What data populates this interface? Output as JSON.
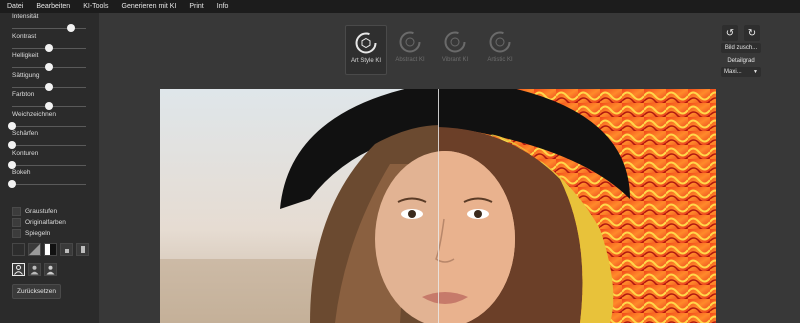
{
  "menu": [
    "Datei",
    "Bearbeiten",
    "KI-Tools",
    "Generieren mit KI",
    "Print",
    "Info"
  ],
  "sidebar": {
    "sliders": [
      {
        "label": "Intensität",
        "value": 0.8
      },
      {
        "label": "Kontrast",
        "value": 0.5
      },
      {
        "label": "Helligkeit",
        "value": 0.5
      },
      {
        "label": "Sättigung",
        "value": 0.5
      },
      {
        "label": "Farbton",
        "value": 0.5
      },
      {
        "label": "Weichzeichnen",
        "value": 0.0
      },
      {
        "label": "Schärfen",
        "value": 0.0
      },
      {
        "label": "Konturen",
        "value": 0.0
      },
      {
        "label": "Bokeh",
        "value": 0.0
      }
    ],
    "checks": [
      "Graustufen",
      "Originalfarben",
      "Spiegeln"
    ],
    "reset_label": "Zurücksetzen"
  },
  "styles": [
    {
      "label": "Art Style KI",
      "active": true
    },
    {
      "label": "Abstract KI",
      "active": false
    },
    {
      "label": "Vibrant KI",
      "active": false
    },
    {
      "label": "Artistic KI",
      "active": false
    }
  ],
  "right_panel": {
    "bild_label": "Bild zusch...",
    "detail_label": "Detailgrad",
    "detail_value": "Maxi..."
  },
  "colors": {
    "menubar": "#1c1c1c",
    "sidebar": "#2b2b2b",
    "workspace": "#383838",
    "accent": "#f2f2f2"
  },
  "icons": [
    "undo-icon",
    "redo-icon",
    "chevron-down-icon",
    "style-ring-icon"
  ]
}
